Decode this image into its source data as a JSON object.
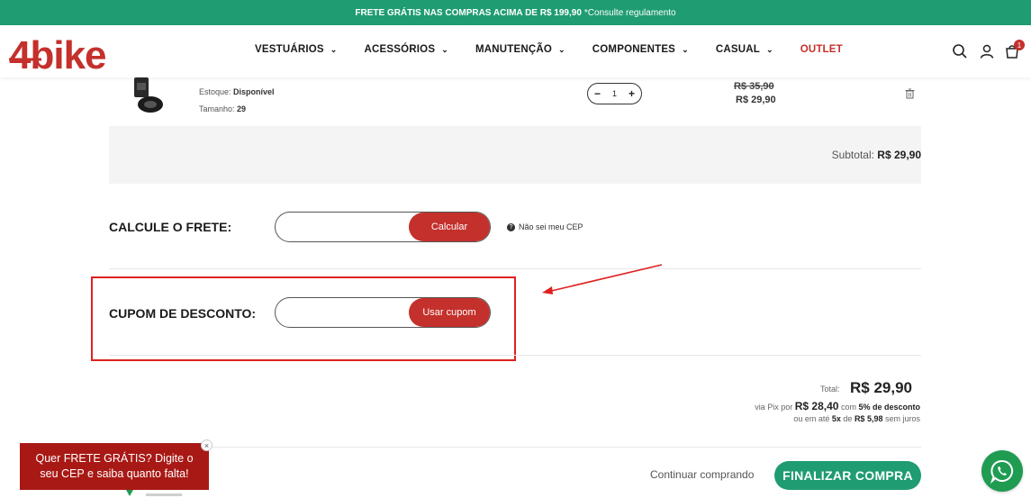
{
  "topbar": {
    "promo": "FRETE GRÁTIS NAS COMPRAS ACIMA DE R$ 199,90",
    "note": "*Consulte regulamento"
  },
  "header": {
    "logo_text": "4bike",
    "nav": [
      {
        "label": "VESTUÁRIOS",
        "has_dropdown": true
      },
      {
        "label": "ACESSÓRIOS",
        "has_dropdown": true
      },
      {
        "label": "MANUTENÇÃO",
        "has_dropdown": true
      },
      {
        "label": "COMPONENTES",
        "has_dropdown": true
      },
      {
        "label": "CASUAL",
        "has_dropdown": true
      },
      {
        "label": "OUTLET",
        "has_dropdown": false
      }
    ],
    "cart_count": "1",
    "icons": [
      "search-icon",
      "user-icon",
      "cart-icon"
    ]
  },
  "cart_item": {
    "stock_label": "Estoque:",
    "stock_value": "Disponível",
    "size_label": "Tamanho:",
    "size_value": "29",
    "quantity": "1",
    "old_price": "R$ 35,90",
    "new_price": "R$ 29,90"
  },
  "subtotal": {
    "label": "Subtotal:",
    "value": "R$ 29,90"
  },
  "shipping": {
    "label": "CALCULE O FRETE:",
    "input_value": "",
    "button": "Calcular",
    "help": "Não sei meu CEP"
  },
  "coupon": {
    "label": "CUPOM DE DESCONTO:",
    "input_value": "",
    "button": "Usar cupom"
  },
  "total": {
    "label": "Total:",
    "value": "R$ 29,90",
    "pix_prefix": "via Pix por",
    "pix_value": "R$ 28,40",
    "pix_with": "com",
    "pix_discount": "5% de desconto",
    "install_prefix": "ou em até",
    "install_count": "5x",
    "install_de": "de",
    "install_value": "R$ 5,98",
    "install_suffix": "sem juros"
  },
  "actions": {
    "continue": "Continuar comprando",
    "checkout": "FINALIZAR COMPRA"
  },
  "promo_popup": {
    "text": "Quer FRETE GRÁTIS? Digite o seu CEP e saiba quanto falta!",
    "close": "×"
  },
  "colors": {
    "brand_green": "#1f9c72",
    "brand_red": "#c4302b",
    "annotation_red": "#e02020"
  }
}
